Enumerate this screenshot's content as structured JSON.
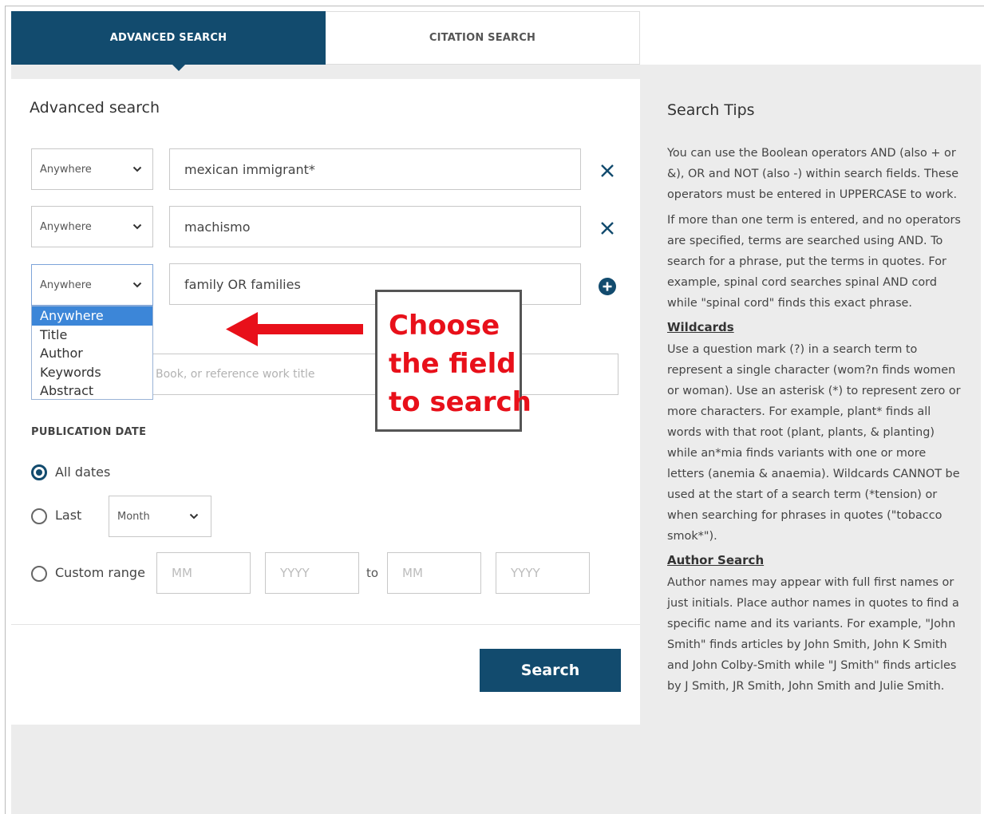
{
  "tabs": {
    "advanced": "ADVANCED SEARCH",
    "citation": "CITATION SEARCH"
  },
  "form": {
    "title": "Advanced search",
    "rows": [
      {
        "field": "Anywhere",
        "term": "mexican immigrant*"
      },
      {
        "field": "Anywhere",
        "term": "machismo"
      },
      {
        "field": "Anywhere",
        "term": "family OR families"
      }
    ],
    "field_options": [
      "Anywhere",
      "Title",
      "Author",
      "Keywords",
      "Abstract"
    ],
    "publication_placeholder": "Book, or reference work title",
    "pub_date_label": "PUBLICATION DATE",
    "all_dates_label": "All dates",
    "last_label": "Last",
    "last_unit": "Month",
    "custom_range_label": "Custom range",
    "mm_placeholder": "MM",
    "yyyy_placeholder": "YYYY",
    "to_label": "to",
    "search_button": "Search"
  },
  "callout": {
    "lines": [
      "Choose",
      "the field",
      "to search"
    ],
    "color": "#e8101a"
  },
  "tips": {
    "title": "Search Tips",
    "intro_1": "You can use the Boolean operators AND (also + or &), OR and NOT (also -) within search fields. These operators must be entered in UPPERCASE to work.",
    "intro_2": "If more than one term is entered, and no operators are specified, terms are searched using AND.  To search for a phrase, put the terms in quotes.  For example, spinal cord searches spinal AND cord while \"spinal cord\" finds this exact phrase.",
    "wildcards_heading": "Wildcards",
    "wildcards_text": "Use a question mark (?) in a search term to represent a single character (wom?n finds women or woman).  Use an asterisk (*) to represent zero or more characters.   For example, plant* finds all words with that root (plant, plants, & planting) while an*mia finds variants with one or more letters (anemia & anaemia).  Wildcards CANNOT be used at the start of a search term (*tension) or when searching for phrases in quotes (\"tobacco smok*\").",
    "author_heading": "Author Search",
    "author_text": "Author names may appear with full first names or just initials.  Place author names in quotes to find a specific name and its variants.  For example, \"John Smith\" finds articles by John Smith, John K Smith and John Colby-Smith while \"J Smith\" finds articles by J Smith, JR Smith, John Smith and Julie Smith."
  },
  "colors": {
    "primary": "#124b6e",
    "selected_option": "#3c86d8"
  }
}
